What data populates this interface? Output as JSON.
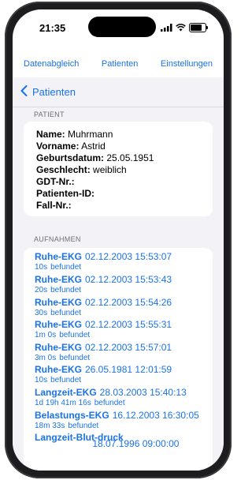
{
  "status": {
    "time": "21:35"
  },
  "topnav": {
    "items": [
      "Datenabgleich",
      "Patienten",
      "Einstellungen"
    ]
  },
  "back": {
    "label": "Patienten"
  },
  "patient": {
    "header": "PATIENT",
    "fields": [
      {
        "label": "Name:",
        "value": "Muhrmann"
      },
      {
        "label": "Vorname:",
        "value": "Astrid"
      },
      {
        "label": "Geburtsdatum:",
        "value": "25.05.1951"
      },
      {
        "label": "Geschlecht:",
        "value": "weiblich"
      },
      {
        "label": "GDT-Nr.:",
        "value": ""
      },
      {
        "label": "Patienten-ID:",
        "value": ""
      },
      {
        "label": "Fall-Nr.:",
        "value": ""
      }
    ]
  },
  "recordings": {
    "header": "AUFNAHMEN",
    "items": [
      {
        "type": "Ruhe-EKG",
        "datetime": "02.12.2003 15:53:07",
        "duration": "10s",
        "status": "befundet"
      },
      {
        "type": "Ruhe-EKG",
        "datetime": "02.12.2003 15:53:43",
        "duration": "20s",
        "status": "befundet"
      },
      {
        "type": "Ruhe-EKG",
        "datetime": "02.12.2003 15:54:26",
        "duration": "30s",
        "status": "befundet"
      },
      {
        "type": "Ruhe-EKG",
        "datetime": "02.12.2003 15:55:31",
        "duration": "1m 0s",
        "status": "befundet"
      },
      {
        "type": "Ruhe-EKG",
        "datetime": "02.12.2003 15:57:01",
        "duration": "3m 0s",
        "status": "befundet"
      },
      {
        "type": "Ruhe-EKG",
        "datetime": "26.05.1981 12:01:59",
        "duration": "10s",
        "status": "befundet"
      },
      {
        "type": "Langzeit-EKG",
        "datetime": "28.03.2003 15:40:13",
        "duration": "1d 19h 41m 16s",
        "status": "befundet"
      },
      {
        "type": "Belastungs-EKG",
        "datetime": "16.12.2003 16:30:05",
        "duration": "18m 33s",
        "status": "befundet"
      },
      {
        "type": "Langzeit-Blut-druck",
        "datetime": "18.07.1996 09:00:00",
        "duration": "",
        "status": ""
      }
    ]
  },
  "colors": {
    "accent": "#1a73e8",
    "background": "#f2f2f7",
    "card": "#ffffff",
    "header_text": "#6e6e73"
  }
}
